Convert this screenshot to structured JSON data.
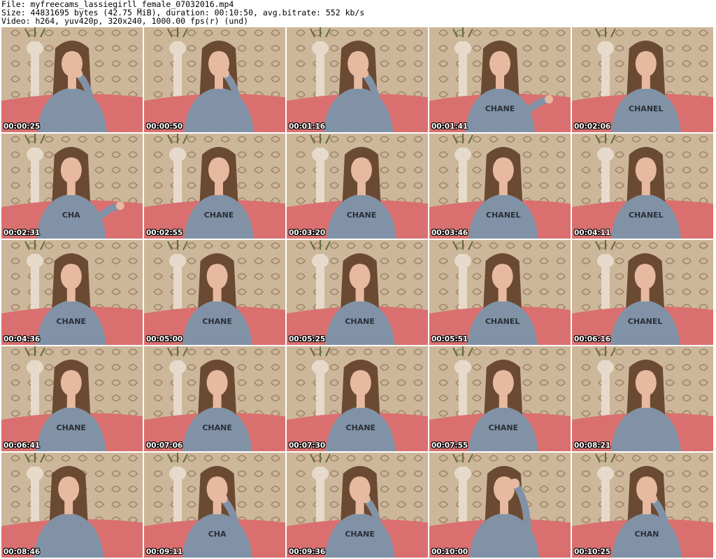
{
  "header": {
    "file_line": "File: myfreecams_lassiegirll_female_07032016.mp4",
    "size_line": "Size: 44831695 bytes (42.75 MiB), duration: 00:10:50, avg.bitrate: 552 kb/s",
    "video_line": "Video: h264, yuv420p, 320x240, 1000.00 fps(r) (und)"
  },
  "colors": {
    "wallpaper": "#cdb79a",
    "wallpaper_pattern": "#7a5c45",
    "bed": "#d9706f",
    "sweater": "#8192a6",
    "hair": "#6b4a33",
    "skin": "#e6b9a0",
    "vase": "#e8dccd"
  },
  "frames": [
    {
      "timestamp": "00:00:25",
      "text": "",
      "lean": 0,
      "hand": "chin"
    },
    {
      "timestamp": "00:00:50",
      "text": "",
      "lean": 0.5,
      "hand": "chin"
    },
    {
      "timestamp": "00:01:16",
      "text": "",
      "lean": 0.1,
      "hand": "chin"
    },
    {
      "timestamp": "00:01:41",
      "text": "CHANE",
      "lean": 0,
      "hand": "out"
    },
    {
      "timestamp": "00:02:06",
      "text": "CHANEL",
      "lean": 0.4,
      "hand": "none"
    },
    {
      "timestamp": "00:02:31",
      "text": "CHA",
      "lean": -0.1,
      "hand": "out"
    },
    {
      "timestamp": "00:02:55",
      "text": "CHANE",
      "lean": 0.5,
      "hand": "none"
    },
    {
      "timestamp": "00:03:20",
      "text": "CHANE",
      "lean": 0.5,
      "hand": "none"
    },
    {
      "timestamp": "00:03:46",
      "text": "CHANEL",
      "lean": 0.4,
      "hand": "none"
    },
    {
      "timestamp": "00:04:11",
      "text": "CHANEL",
      "lean": 0.4,
      "hand": "none"
    },
    {
      "timestamp": "00:04:36",
      "text": "CHANE",
      "lean": -0.1,
      "hand": "none"
    },
    {
      "timestamp": "00:05:00",
      "text": "CHANE",
      "lean": 0.3,
      "hand": "none"
    },
    {
      "timestamp": "00:05:25",
      "text": "CHANE",
      "lean": 0.3,
      "hand": "none"
    },
    {
      "timestamp": "00:05:51",
      "text": "CHANEL",
      "lean": 0.3,
      "hand": "none"
    },
    {
      "timestamp": "00:06:16",
      "text": "CHANEL",
      "lean": 0.3,
      "hand": "none"
    },
    {
      "timestamp": "00:06:41",
      "text": "CHANE",
      "lean": -0.1,
      "hand": "none"
    },
    {
      "timestamp": "00:07:06",
      "text": "CHANE",
      "lean": 0.3,
      "hand": "none"
    },
    {
      "timestamp": "00:07:30",
      "text": "CHANE",
      "lean": 0.4,
      "hand": "none"
    },
    {
      "timestamp": "00:07:55",
      "text": "CHANE",
      "lean": 0.4,
      "hand": "none"
    },
    {
      "timestamp": "00:08:21",
      "text": "",
      "lean": 0.4,
      "hand": "none"
    },
    {
      "timestamp": "00:08:46",
      "text": "",
      "lean": -0.4,
      "hand": "none"
    },
    {
      "timestamp": "00:09:11",
      "text": "CHA",
      "lean": 0.3,
      "hand": "chin"
    },
    {
      "timestamp": "00:09:36",
      "text": "CHANE",
      "lean": 0.3,
      "hand": "chin"
    },
    {
      "timestamp": "00:10:00",
      "text": "",
      "lean": 0.5,
      "hand": "head"
    },
    {
      "timestamp": "00:10:25",
      "text": "CHAN",
      "lean": 0.5,
      "hand": "chin"
    }
  ]
}
